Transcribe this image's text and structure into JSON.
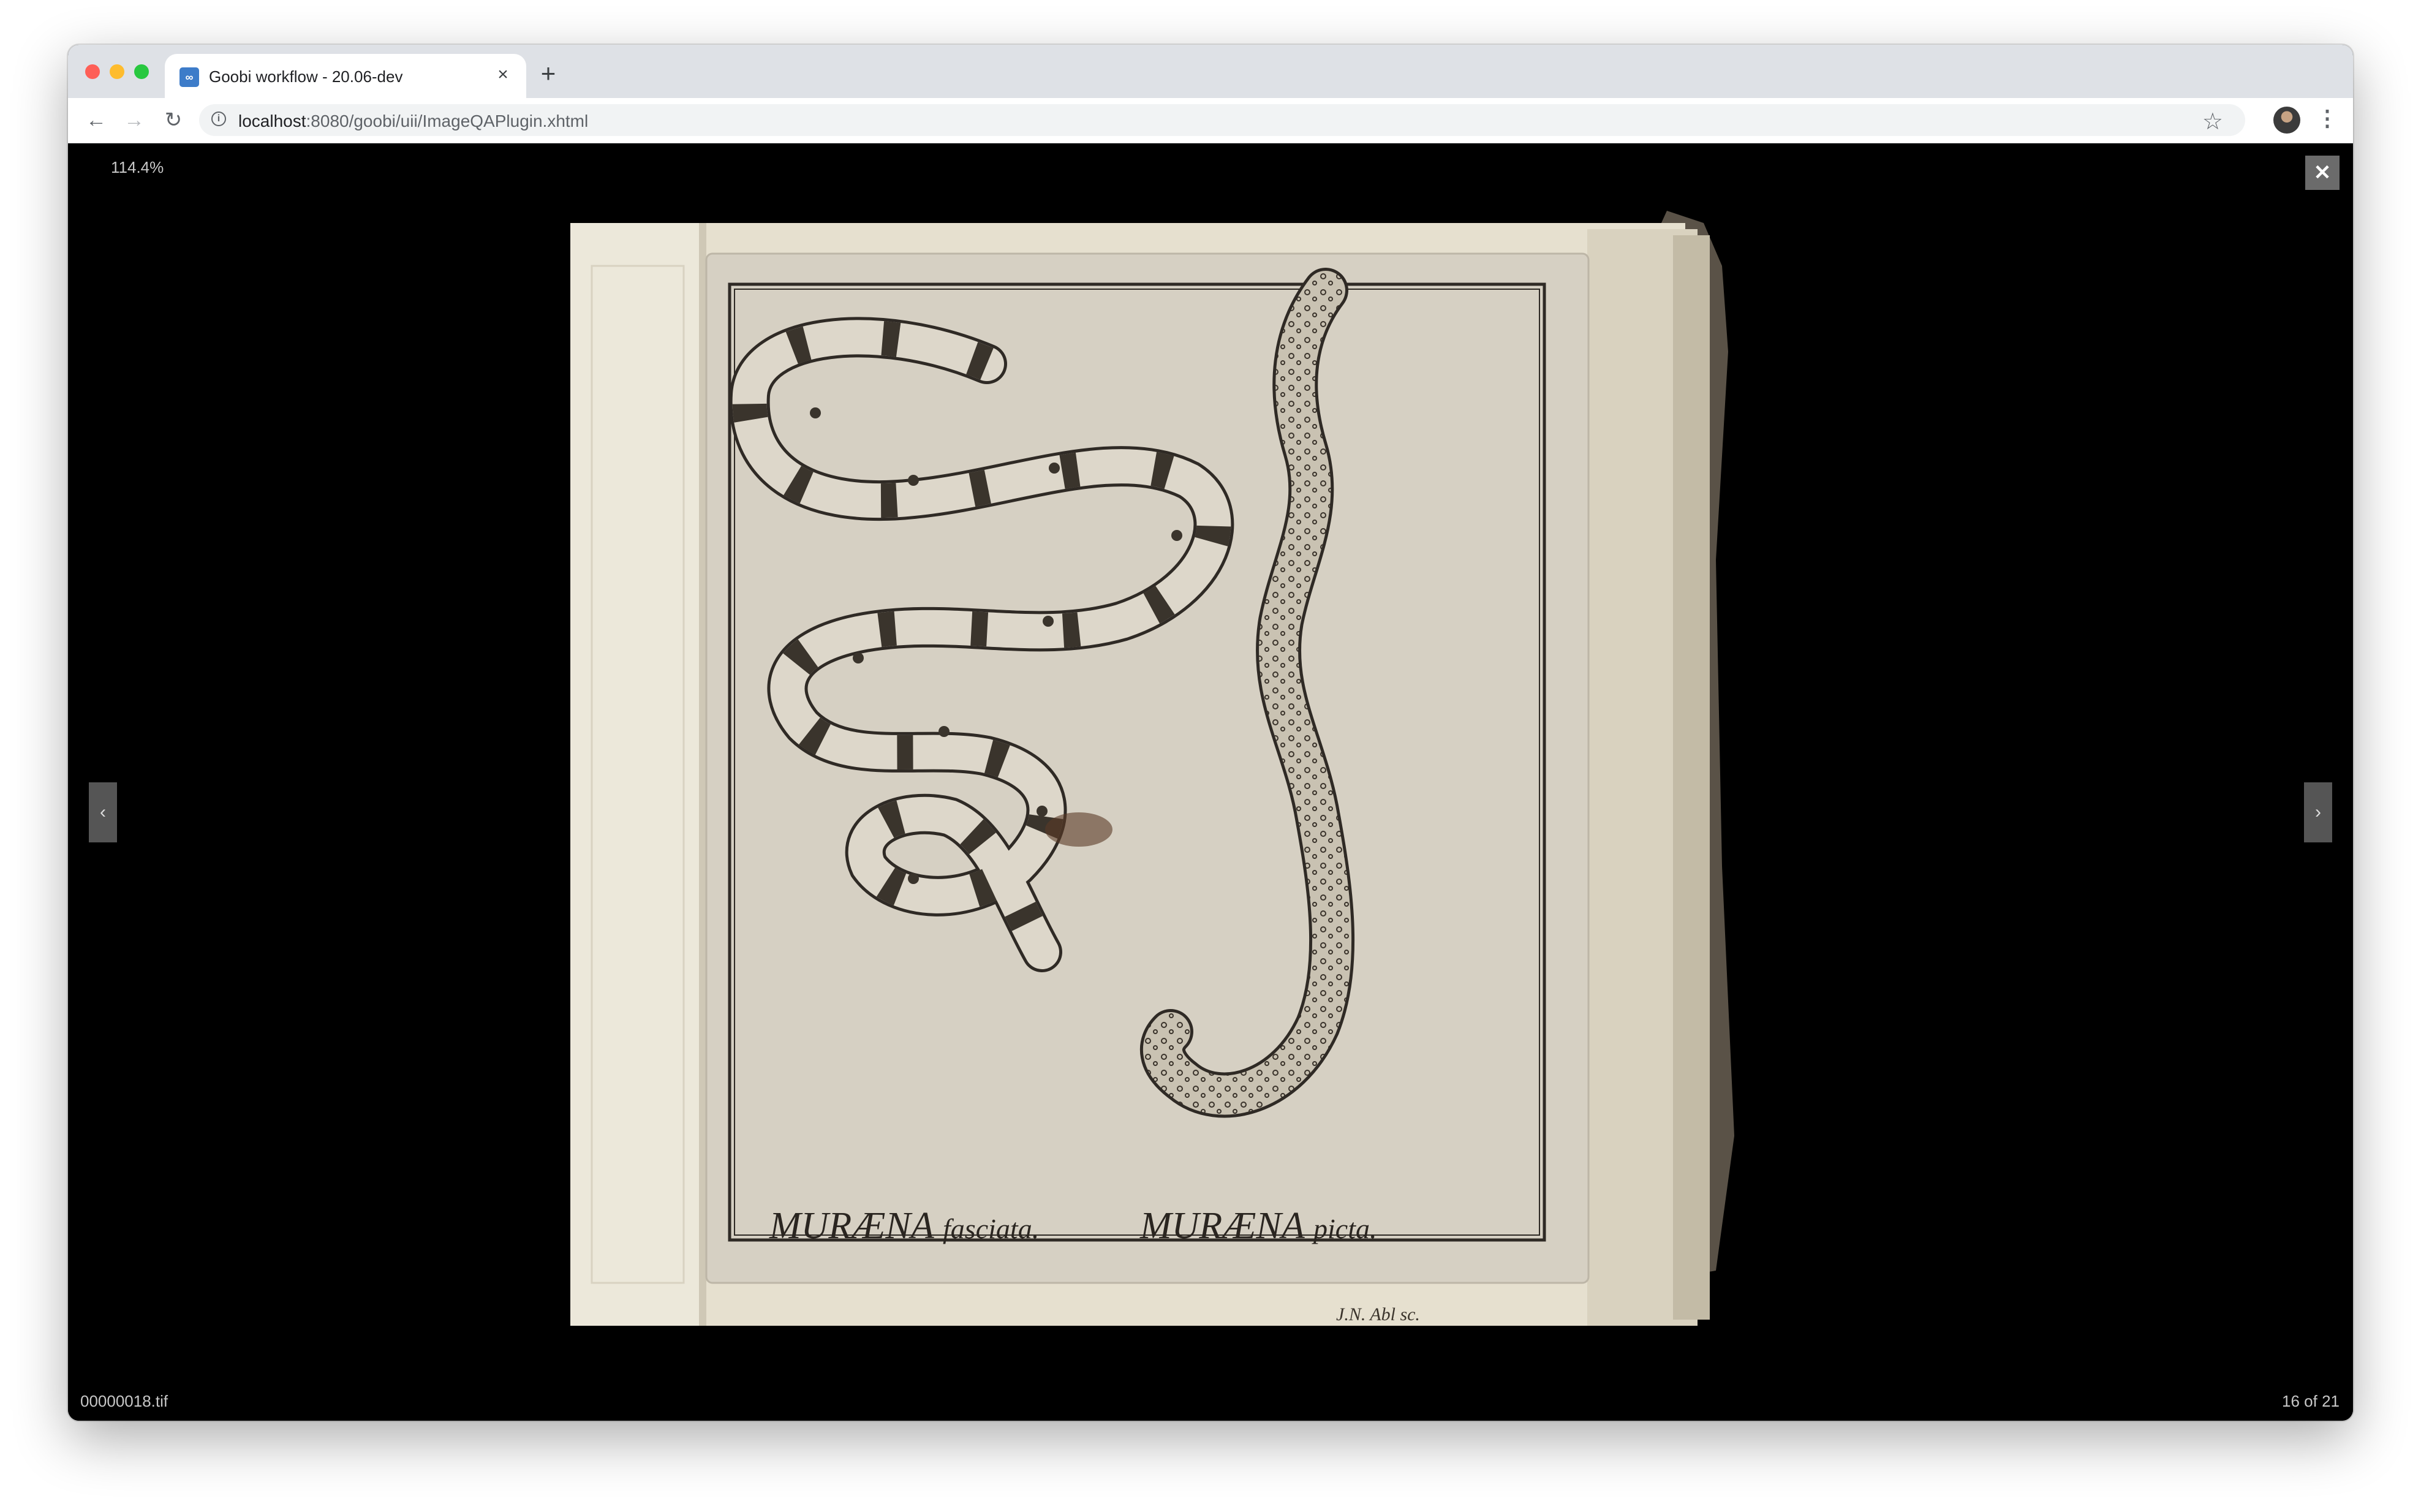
{
  "browser": {
    "tab": {
      "title": "Goobi workflow - 20.06-dev",
      "favicon": "infinity-icon",
      "close_icon": "close-icon"
    },
    "new_tab_icon": "plus-icon",
    "address_bar": {
      "host": "localhost",
      "path": ":8080/goobi/uii/ImageQAPlugin.xhtml"
    },
    "icons": {
      "back": "back-arrow-icon",
      "forward": "forward-arrow-icon",
      "reload": "reload-icon",
      "info": "info-icon",
      "bookmark": "star-icon",
      "menu": "kebab-menu-icon"
    }
  },
  "viewer": {
    "zoom": "114.4%",
    "filename": "00000018.tif",
    "page_count": "16 of 21",
    "close_icon": "close-icon",
    "prev_icon": "chevron-left-icon",
    "next_icon": "chevron-right-icon",
    "image": {
      "caption_left_main": "MURÆNA",
      "caption_left_sub": "fasciata.",
      "caption_right_main": "MURÆNA",
      "caption_right_sub": "picta.",
      "engraver": "J.N. Abl sc."
    }
  },
  "colors": {
    "viewer_background": "#000000",
    "tabstrip": "#dee1e6",
    "paper": "#dcd5c4"
  }
}
